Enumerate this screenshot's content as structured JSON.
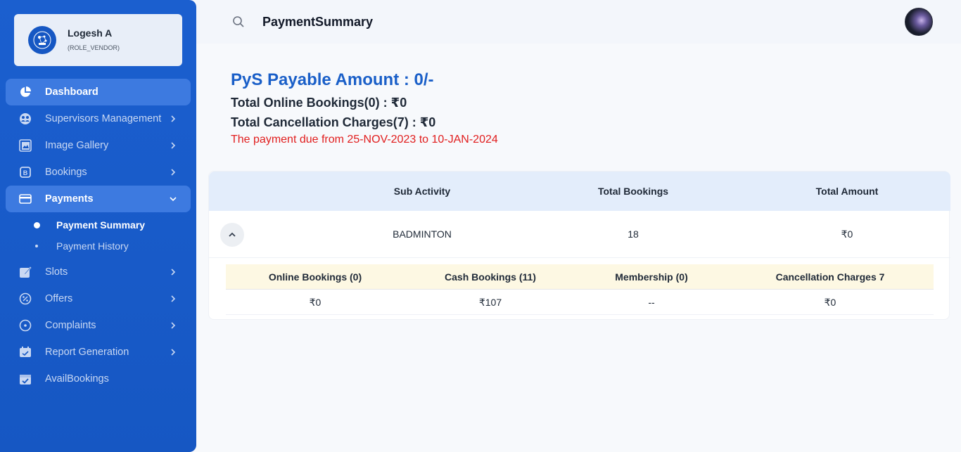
{
  "user": {
    "name": "Logesh A",
    "role": "(ROLE_VENDOR)"
  },
  "sidebar": {
    "items": [
      {
        "label": "Dashboard",
        "icon": "pie-chart-icon"
      },
      {
        "label": "Supervisors Management",
        "icon": "users-group-icon"
      },
      {
        "label": "Image Gallery",
        "icon": "gallery-icon"
      },
      {
        "label": "Bookings",
        "icon": "booking-icon"
      },
      {
        "label": "Payments",
        "icon": "credit-card-icon"
      },
      {
        "label": "Slots",
        "icon": "edit-calendar-icon"
      },
      {
        "label": "Offers",
        "icon": "offer-badge-icon"
      },
      {
        "label": "Complaints",
        "icon": "complaint-circle-icon"
      },
      {
        "label": "Report Generation",
        "icon": "report-calendar-icon"
      },
      {
        "label": "AvailBookings",
        "icon": "calendar-check-icon"
      }
    ],
    "payments_sub": [
      {
        "label": "Payment Summary"
      },
      {
        "label": "Payment History"
      }
    ]
  },
  "header": {
    "title": "PaymentSummary"
  },
  "summary": {
    "payable": "PyS Payable Amount : 0/-",
    "online": "Total Online Bookings(0) : ₹0",
    "cancellation": "Total Cancellation Charges(7) : ₹0",
    "due": "The payment due from 25-NOV-2023 to 10-JAN-2024"
  },
  "table": {
    "headers": [
      "Sub Activity",
      "Total Bookings",
      "Total Amount"
    ],
    "row": {
      "sub_activity": "BADMINTON",
      "total_bookings": "18",
      "total_amount": "₹0"
    }
  },
  "subtable": {
    "headers": [
      "Online Bookings (0)",
      "Cash Bookings (11)",
      "Membership (0)",
      "Cancellation Charges 7"
    ],
    "values": [
      "₹0",
      "₹107",
      "--",
      "₹0"
    ]
  },
  "colors": {
    "sidebar": "#1657c3",
    "accent": "#1a5fc8",
    "due": "#e11d1d",
    "table_header": "#e3edfb",
    "subtable_header": "#fdf8e3"
  }
}
